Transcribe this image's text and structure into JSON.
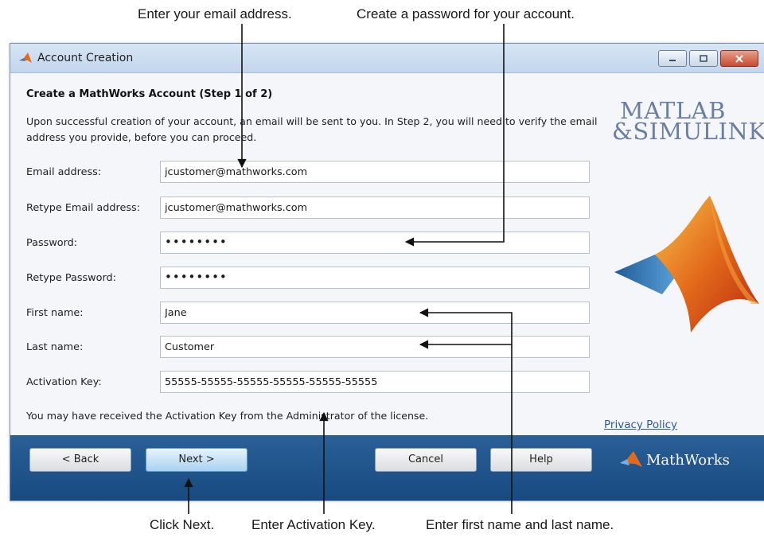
{
  "callouts": {
    "email": "Enter your email address.",
    "password": "Create a password for your account.",
    "next": "Click Next.",
    "activation": "Enter Activation Key.",
    "name": "Enter first name and last name."
  },
  "window": {
    "title": "Account Creation"
  },
  "form": {
    "heading": "Create a MathWorks Account (Step 1 of 2)",
    "intro": "Upon successful creation of your account, an email will be sent to you. In Step 2, you will need to verify the email address you provide, before you can proceed.",
    "fields": [
      {
        "label": "Email address:",
        "value": "jcustomer@mathworks.com"
      },
      {
        "label": "Retype Email address:",
        "value": "jcustomer@mathworks.com"
      },
      {
        "label": "Password:",
        "value": "••••••••"
      },
      {
        "label": "Retype Password:",
        "value": "••••••••"
      },
      {
        "label": "First name:",
        "value": "Jane"
      },
      {
        "label": "Last name:",
        "value": "Customer"
      },
      {
        "label": "Activation Key:",
        "value": "55555-55555-55555-55555-55555-55555"
      }
    ],
    "note": "You may have received the Activation Key from the Administrator of the license.",
    "privacy": "Privacy Policy"
  },
  "branding": {
    "matlab_line1": "MATLAB",
    "matlab_line2": "&SIMULINK",
    "mathworks": "MathWorks",
    "accent_color": "#e36a1b",
    "footer_color": "#1f5389"
  },
  "footer": {
    "back": "< Back",
    "next": "Next >",
    "cancel": "Cancel",
    "help": "Help"
  }
}
